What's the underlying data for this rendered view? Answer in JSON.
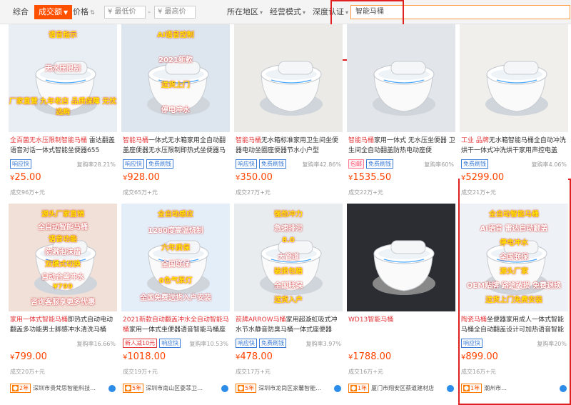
{
  "toolbar": {
    "items": [
      "综合",
      "成交额",
      "价格",
      "¥ 最低价",
      "¥ 最高价",
      "所在地区",
      "经营模式",
      "深度认证"
    ],
    "sep": "-",
    "search": "智能马桶"
  },
  "cards": [
    {
      "title_pre": "全百菌无水压限制",
      "title_kw": "智能马桶",
      "title_post": " 雷达翻盖语音对话一体式智能坐便器655",
      "tags": [
        "响应快"
      ],
      "rate": "复购率28.21%",
      "price": "25.00",
      "sold": "成交96万+元",
      "years": "9年",
      "shop": "潮州市枫溪区金百菌智能卫…",
      "ovl": [
        "语音指示",
        "无水压限制",
        "厂家直营  九年老店  品质保障  无忧选购"
      ]
    },
    {
      "title_pre": "智能马桶",
      "title_kw": "",
      "title_post": "一体式无水箱家用全自动翻盖座便器无水压限制即热式坐便器马桶",
      "tags": [
        "响应快",
        "免费刷钱"
      ],
      "rate": "",
      "price": "928.00",
      "sold": "成交65万+元",
      "years": "5年",
      "shop": "深圳市东陶卫浴有限公司",
      "ovl": [
        "AI语音控制",
        "2021新款",
        "送货上门",
        "停电冲水"
      ]
    },
    {
      "title_pre": "智能马桶",
      "title_kw": "",
      "title_post": "无水箱标准家用卫生间坐便器电动坐圈座便器节水小户型",
      "tags": [
        "响应快",
        "免费刷钱"
      ],
      "rate": "复购率42.86%",
      "price": "350.00",
      "sold": "成交27万+元",
      "years": "1年",
      "shop": "潮州市鼎维卫浴有限公司",
      "ovl": []
    },
    {
      "title_pre": "智能马桶",
      "title_kw": "",
      "title_post": "家用一体式 无水压坐便器 卫生间全自动翻盖防热电动座便",
      "tags": [
        "包邮",
        "免费刷钱"
      ],
      "rate": "复购率60%",
      "price": "1535.50",
      "sold": "成交22万+元",
      "years": "3年",
      "shop": "深圳市宝安区新桥王卫…",
      "ovl": []
    },
    {
      "title_pre": "工业 品牌",
      "title_kw": "",
      "title_post": "无水箱智能马桶全自动冲洗烘干一体式冲洗烘干家用声控电盖",
      "tags": [
        "免费刷钱"
      ],
      "rate": "复购率4.06%",
      "price": "5299.00",
      "sold": "成交21万+元",
      "years": "1年",
      "shop": "奥得宜方旗舰店",
      "ovl": []
    },
    {
      "title_pre": "家用一体式",
      "title_kw": "智能马桶",
      "title_post": "即热式自动电动翻盖多功能男士脚感冲水清洗马桶",
      "tags": [],
      "rate": "复购率16.66%",
      "price": "799.00",
      "sold": "成交20万+元",
      "years": "2年",
      "shop": "深圳市贵梵思智能科技…",
      "ovl": [
        "源头厂家直销",
        "全自动智能马桶",
        "语音功能",
        "防溅泡沫盾",
        "双模式切换",
        "自动合盖冲水",
        "¥799",
        "咨询客服享更多优惠"
      ]
    },
    {
      "title_pre": "2021新款自动翻盖冲水全自动",
      "title_kw": "智能马桶",
      "title_post": "家用一体式坐便器语音智能马桶座便器马桶",
      "tags": [
        "新人减10元",
        "响应快"
      ],
      "rate": "复购率10.53%",
      "price": "1018.00",
      "sold": "成交19万+元",
      "years": "5年",
      "shop": "深圳市南山区委菲卫…",
      "ovl": [
        "全自动感应",
        "1280度高温烧制",
        "六年质保",
        "全国联保",
        "6色气泵灯",
        "全国免费送货入户安装"
      ]
    },
    {
      "title_pre": "箭牌ARROW",
      "title_kw": "马桶",
      "title_post": "家用超漩虹吸式冲水节水静音防臭马桶一体式座便器",
      "tags": [
        "响应快",
        "免费刷钱"
      ],
      "rate": "复购率3.97%",
      "price": "478.00",
      "sold": "成交17万+元",
      "years": "5年",
      "shop": "深圳市龙岗区家馨智能…",
      "ovl": [
        "强劲冲力",
        "急速排污",
        "8.0",
        "大管道",
        "破损包赔",
        "全国联保",
        "送货入户"
      ]
    },
    {
      "title_pre": "WD13",
      "title_kw": "智能马桶",
      "title_post": "",
      "tags": [],
      "rate": "",
      "price": "1788.00",
      "sold": "成交16万+元",
      "years": "1年",
      "shop": "厦门市翔安区蔡道建材店",
      "ovl": []
    },
    {
      "title_pre": "陶瓷",
      "title_kw": "马桶",
      "title_post": "坐便器家用成人一体式智能马桶全自动翻盖设计可加热语音智能马桶",
      "tags": [
        "响应快"
      ],
      "rate": "复购率20%",
      "price": "899.00",
      "sold": "成交16万+元",
      "years": "1年",
      "shop": "潮州市…",
      "ovl": [
        "全自动智能马桶",
        "AI语音 雷达自动翻盖",
        "停电冲水",
        "全国联保",
        "源头厂家",
        "OEM贴牌 路途破损 免费退换",
        "送货上门免费安装"
      ]
    }
  ]
}
